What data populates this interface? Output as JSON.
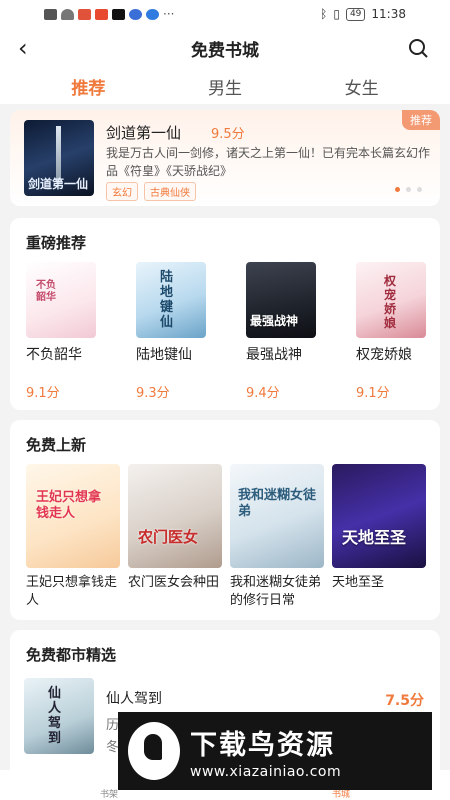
{
  "status": {
    "time": "11:38",
    "battery": "49",
    "icons": [
      "sim-icon",
      "wifi-icon",
      "app-icon-1",
      "app-icon-2",
      "tiktok-icon",
      "app-icon-3",
      "app-icon-4",
      "more-icon"
    ]
  },
  "navbar": {
    "title": "免费书城"
  },
  "tabs": [
    {
      "label": "推荐",
      "active": true
    },
    {
      "label": "男生",
      "active": false
    },
    {
      "label": "女生",
      "active": false
    }
  ],
  "featured": {
    "badge": "推荐",
    "cover_text": "剑道第一仙",
    "title": "剑道第一仙",
    "score": "9.5分",
    "desc": "我是万古人间一剑修，诸天之上第一仙！已有完本长篇玄幻作品《符皇》《天骄战纪》",
    "tags": [
      "玄幻",
      "古典仙侠"
    ]
  },
  "heavy": {
    "title": "重磅推荐",
    "books": [
      {
        "name": "不负韶华",
        "score": "9.1分",
        "cover_text": "不负韶华"
      },
      {
        "name": "陆地键仙",
        "score": "9.3分",
        "cover_text": "陆地键仙"
      },
      {
        "name": "最强战神",
        "score": "9.4分",
        "cover_text": "最强战神"
      },
      {
        "name": "权宠娇娘",
        "score": "9.1分",
        "cover_text": "权宠娇娘"
      }
    ]
  },
  "newfree": {
    "title": "免费上新",
    "books": [
      {
        "name": "王妃只想拿钱走人",
        "cover_text": "王妃只想拿钱走人"
      },
      {
        "name": "农门医女会种田",
        "cover_text": "农门医女"
      },
      {
        "name": "我和迷糊女徒弟的修行日常",
        "cover_text": "我和迷糊女徒弟"
      },
      {
        "name": "天地至圣",
        "cover_text": "天地至圣"
      }
    ]
  },
  "city": {
    "title": "免费都市精选",
    "book": {
      "name": "仙人驾到",
      "score": "7.5分",
      "desc1": "历",
      "desc2": "冬",
      "cover_text": "仙人驾到"
    }
  },
  "watermark": {
    "title": "下载鸟资源",
    "url": "www.xiazainiao.com"
  },
  "bottom": {
    "left": "书架",
    "right": "书城"
  }
}
